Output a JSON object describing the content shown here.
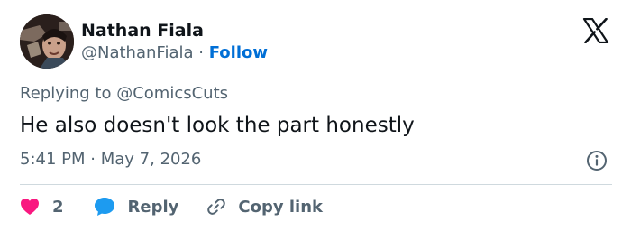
{
  "author": {
    "display_name": "Nathan Fiala",
    "handle": "@NathanFiala",
    "separator": "·",
    "follow_label": "Follow"
  },
  "tweet": {
    "replying_to": "Replying to @ComicsCuts",
    "text": "He also doesn't look the part honestly",
    "time": "5:41 PM",
    "time_separator": "·",
    "date": "May 7, 2026"
  },
  "actions": {
    "like_count": "2",
    "reply_label": "Reply",
    "copy_link_label": "Copy link"
  },
  "icons": {
    "brand": "x-logo-icon",
    "info": "info-icon",
    "like": "heart-icon",
    "reply": "speech-bubble-icon",
    "copy": "link-icon"
  },
  "colors": {
    "text_primary": "#0f1419",
    "text_secondary": "#536471",
    "link": "#006fd6",
    "like": "#f91880",
    "reply": "#1d9bf0",
    "divider": "#cfd9de"
  }
}
